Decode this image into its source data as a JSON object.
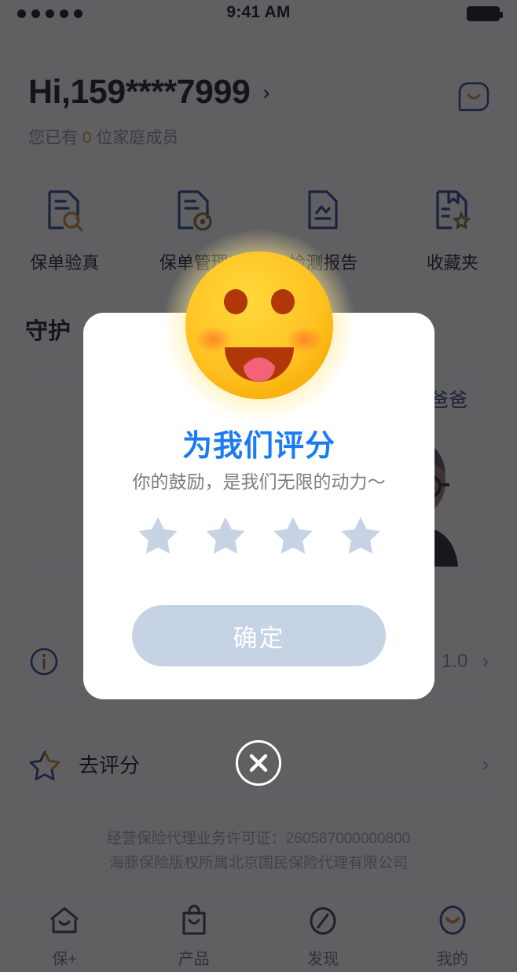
{
  "status_bar": {
    "time": "9:41 AM",
    "signal_dots": 5,
    "battery_full": true
  },
  "header": {
    "greeting": "Hi,159****7999",
    "chevron": "›",
    "family_prefix": "您已有",
    "family_count": "0",
    "family_suffix": "位家庭成员",
    "message_icon": "chat-bubble-icon"
  },
  "quick_actions": [
    {
      "label": "保单验真",
      "icon": "document-search-icon"
    },
    {
      "label": "保单管理",
      "icon": "document-circle-icon"
    },
    {
      "label": "检测报告",
      "icon": "document-chart-icon"
    },
    {
      "label": "收藏夹",
      "icon": "document-star-icon"
    }
  ],
  "family_section": {
    "title": "守护",
    "member_tab": "爸爸"
  },
  "version_row": {
    "icon": "info-icon",
    "label": "",
    "value": "1.0",
    "chevron": "›"
  },
  "rate_row": {
    "icon": "star-outline-icon",
    "label": "去评分",
    "chevron": "›"
  },
  "footer": {
    "line1": "经营保险代理业务许可证：260587000000800",
    "line2": "海豚保险版权所属北京国民保险代理有限公司"
  },
  "tabbar": [
    {
      "label": "保+",
      "icon": "home-icon",
      "active": false
    },
    {
      "label": "产品",
      "icon": "bag-icon",
      "active": false
    },
    {
      "label": "发现",
      "icon": "compass-icon",
      "active": false
    },
    {
      "label": "我的",
      "icon": "profile-smiley-icon",
      "active": true
    }
  ],
  "modal": {
    "emoji": "grinning-face-emoji",
    "title": "为我们评分",
    "subtitle": "你的鼓励，是我们无限的动力～",
    "star_count": 4,
    "stars_selected": 0,
    "confirm_label": "确定",
    "confirm_color": "#c6d3e5",
    "title_color": "#1a7cf5",
    "close_icon": "close-icon"
  }
}
